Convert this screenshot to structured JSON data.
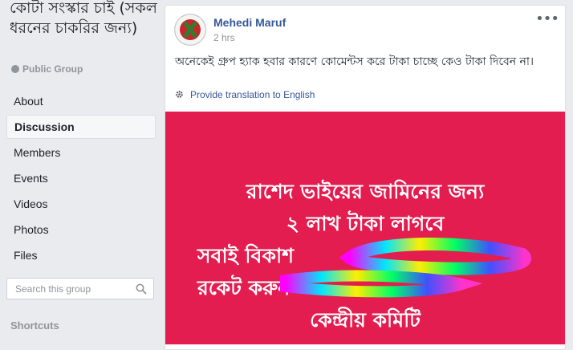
{
  "sidebar": {
    "group_name": "কোটা সংস্কার চাই (সকল ধরনের চাকরির জন্য)",
    "group_type": "Public Group",
    "nav": [
      "About",
      "Discussion",
      "Members",
      "Events",
      "Videos",
      "Photos",
      "Files"
    ],
    "search_placeholder": "Search this group",
    "shortcuts": "Shortcuts"
  },
  "post": {
    "author": "Mehedi Maruf",
    "time": "2 hrs",
    "more_icon": "•••",
    "text": "অনেকেই গ্রুপ হ্যাক হবার কারণে কোমেন্টস করে টাকা চাচ্ছে কেও টাকা দিবেন না।",
    "translate_link": "Provide translation to English",
    "image_lines": [
      "রাশেদ ভাইয়ের জামিনের জন্য",
      "২ লাখ টাকা  লাগবে",
      "সবাই বিকাশ",
      "রকেট                         করুন",
      "কেন্দ্রীয় কমিটি"
    ],
    "image_bg": "#e31d4f"
  },
  "colors": {
    "link": "#365899",
    "muted": "#90949c",
    "page_bg": "#e9ebee"
  }
}
